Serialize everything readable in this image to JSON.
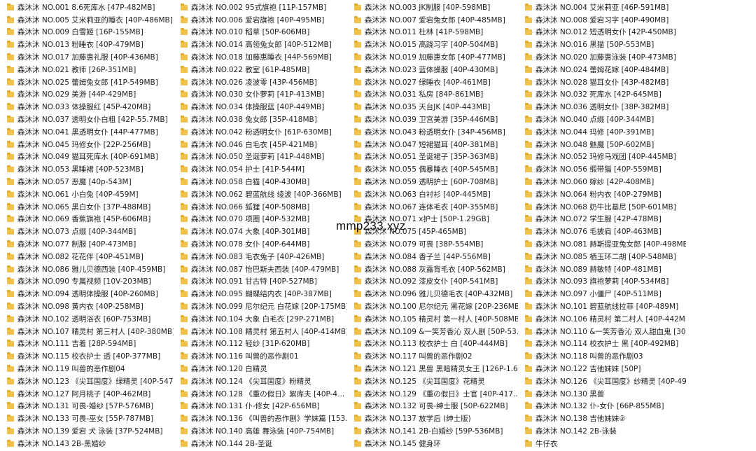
{
  "watermark": "mmp233.xyz",
  "columns": [
    [
      "森沐沐 NO.001 8.6死库水 [47P-482MB]",
      "森沐沐 NO.005 艾米莉亚的睡衣 [40P-486MB]",
      "森沐沐 NO.009 白雪姬 [16P-155MB]",
      "森沐沐 NO.013 粉睡衣 [40P-479MB]",
      "森沐沐 NO.017 加藤惠礼服 [40P-436MB]",
      "森沐沐 NO.021 教师 [26P-351MB]",
      "森沐沐 NO.025 蕾姆兔女郎 [41P-549MB]",
      "森沐沐 NO.029 美游 [44P-429MB]",
      "森沐沐 NO.033 体操服红 [45P-420MB]",
      "森沐沐 NO.037 透明女仆白粗 [42P-55.7MB]",
      "森沐沐 NO.041 黑透明女仆 [44P-477MB]",
      "森沐沐 NO.045 玛修女仆 [22P-256MB]",
      "森沐沐 NO.049 猫耳死库水 [40P-691MB]",
      "森沐沐 NO.053 黑睡裙 [40P-523MB]",
      "森沐沐 NO.057 恶魔 [40p-543M]",
      "森沐沐 NO.061 小白兔 [40P-459M]",
      "森沐沐 NO.065 黑白女仆 [37P-488MB]",
      "森沐沐 NO.069 香蕉旗袍 [45P-606MB]",
      "森沐沐 NO.073 点缀 [40P-344MB]",
      "森沐沐 NO.077 制服 [40P-473MB]",
      "森沐沐 NO.082 花花伴 [40P-451MB]",
      "森沐沐 NO.086 雅儿贝德西装 [40P-459MB]",
      "森沐沐 NO.090 专属视频 [10V-203MB]",
      "森沐沐 NO.094 透明体操服 [40P-260MB]",
      "森沐沐 NO.098 黄内衣 [40P-258MB]",
      "森沐沐 NO.102 透明浴衣 [60P-753MB]",
      "森沐沐 NO.107 精灵村 第三村人 [40P-380MB]",
      "森沐沐 NO.111 吉着 [28P-594MB]",
      "森沐沐 NO.115 校衣护士 透 [40P-377MB]",
      "森沐沐 NO.119 叫兽的恶作剧04",
      "森沐沐 NO.123 《尖耳国度》绿精灵 [40P-547...",
      "森沐沐 NO.127 阿月桃子 [40P-462MB]",
      "森沐沐 NO.131 可畏-婚纱 [57P-576MB]",
      "森沐沐 NO.133 可畏-巫女 [55P-787MB]",
      "森沐沐 NO.139 爱宕 犬 泳装 [37P-524MB]",
      "森沐沐 NO.143 2B-黑婚纱"
    ],
    [
      "森沐沐 NO.002 95式旗袍 [11P-157MB]",
      "森沐沐 NO.006 爱宕旗袍 [40P-495MB]",
      "森沐沐 NO.010 稻草 [50P-606MB]",
      "森沐沐 NO.014 高领兔女郎 [40P-512MB]",
      "森沐沐 NO.018 加藤惠睡衣 [44P-569MB]",
      "森沐沐 NO.022 教室 [61P-485MB]",
      "森沐沐 NO.026 凌波零 [43P-456MB]",
      "森沐沐 NO.030 女仆萝莉 [41P-413MB]",
      "森沐沐 NO.034 体操服蓝 [40P-449MB]",
      "森沐沐 NO.038 兔女郎 [35P-418MB]",
      "森沐沐 NO.042 粉透明女仆 [61P-630MB]",
      "森沐沐 NO.046 白毛衣 [45P-421MB]",
      "森沐沐 NO.050 圣诞萝莉 [41P-448MB]",
      "森沐沐 NO.054 护士 [41P-544M]",
      "森沐沐 NO.058 白猫 [40P-430MB]",
      "森沐沐 NO.062 碧蓝航线 绫波 [40P-366MB]",
      "森沐沐 NO.066 狐狸 [40P-508MB]",
      "森沐沐 NO.070 项圈 [40P-532MB]",
      "森沐沐 NO.074 大象 [40P-301MB]",
      "森沐沐 NO.078 女仆 [40P-644MB]",
      "森沐沐 NO.083 毛衣兔子 [40P-426MB]",
      "森沐沐 NO.087 怡巴斯夫西装 [40P-479MB]",
      "森沐沐 NO.091 甘古特 [40P-527MB]",
      "森沐沐 NO.095 蝴蝶结内衣 [40P-387MB]",
      "森沐沐 NO.099 尼尔纪元 白花嫁 [20P-175MB]",
      "森沐沐 NO.104 大象 白毛衣 [29P-271MB]",
      "森沐沐 NO.108 精灵村 第五村人 [40P-414MB]",
      "森沐沐 NO.112 轻纱 [31P-620MB]",
      "森沐沐 NO.116 叫兽的恶作剧01",
      "森沐沐 NO.120 白精灵",
      "森沐沐 NO.124 《尖耳国度》粉精灵",
      "森沐沐 NO.128 《重の假日》絮库夫 [40P-4...",
      "森沐沐 NO.131 仆-修女 [42P-656MB]",
      "森沐沐 NO.136 《叫兽的恶作剧》学妹篇 [153...",
      "森沐沐 NO.140 高雄 舞泳装 [40P-754MB]",
      "森沐沐 NO.144 2B-圣诞"
    ],
    [
      "森沐沐 NO.003 JK制服 [40P-598MB]",
      "森沐沐 NO.007 爱宕兔女郎 [40P-485MB]",
      "森沐沐 NO.011 杜林 [41P-598MB]",
      "森沐沐 NO.015 高跷习字 [40P-504MB]",
      "森沐沐 NO.019 加藤惠女郎 [40P-477MB]",
      "森沐沐 NO.023 蓝体操服 [40P-430MB]",
      "森沐沐 NO.027 绿睡衣 [40P-461MB]",
      "森沐沐 NO.031 私房 [84P-861MB]",
      "森沐沐 NO.035 天台JK [40P-443MB]",
      "森沐沐 NO.039 卫宫美游 [35P-446MB]",
      "森沐沐 NO.043 粉透明女仆 [34P-456MB]",
      "森沐沐 NO.047 短裙猫耳 [40P-381MB]",
      "森沐沐 NO.051 圣诞裙子 [35P-363MB]",
      "森沐沐 NO.055 偶暴睡衣 [40P-545MB]",
      "森沐沐 NO.059 透明护士 [60P-708MB]",
      "森沐沐 NO.063 白衬衫 [40P-445MB]",
      "森沐沐 NO.067 连体毛衣 [40P-355MB]",
      "森沐沐 NO.071 x护士 [50P-1.29GB]",
      "森沐沐 NO.075 [45P-465MB]",
      "森沐沐 NO.079 可畏 [38P-554MB]",
      "森沐沐 NO.084 香子兰 [44P-556MB]",
      "森沐沐 NO.088 灰露背毛衣 [40P-562MB]",
      "森沐沐 NO.092 漆皮女仆 [40P-541MB]",
      "森沐沐 NO.096 雅儿贝德毛衣 [40P-432MB]",
      "森沐沐 NO.100 尼尔纪元 黑花嫁 [20P-236MB]",
      "森沐沐 NO.105 精灵村 第一村人 [40P-508MB]",
      "森沐沐 NO.109 &一笑芳香沁 双人剧 [50P-53...",
      "森沐沐 NO.113 校衣护士 白 [40P-444MB]",
      "森沐沐 NO.117 叫兽的恶作剧02",
      "森沐沐 NO.121 黑兽 黑暗精灵女王 [126P-1.6...",
      "森沐沐 NO.125 《尖耳国度》花精灵",
      "森沐沐 NO.129 《重の假日》士官 [40P-417...",
      "森沐沐 NO.132 可畏-绅士服 [50P-622MB]",
      "森沐沐 NO.137 放学后 (绅士版)",
      "森沐沐 NO.141 2B-白婚纱 [59P-536MB]",
      "森沐沐 NO.145 健身环"
    ],
    [
      "森沐沐 NO.004 艾米莉亚 [46P-591MB]",
      "森沐沐 NO.008 爱宕习字 [40P-490MB]",
      "森沐沐 NO.012 短透明女仆 [42P-450MB]",
      "森沐沐 NO.016 黑猫 [50P-553MB]",
      "森沐沐 NO.020 加藤惠泳装 [40P-473MB]",
      "森沐沐 NO.024 蕾姆花嫁 [40P-484MB]",
      "森沐沐 NO.028 猫耳女仆 [43P-482MB]",
      "森沐沐 NO.032 死库水 [42P-645MB]",
      "森沐沐 NO.036 透明女仆 [38P-382MB]",
      "森沐沐 NO.040 点缀 [40P-344MB]",
      "森沐沐 NO.044 玛修 [40P-391MB]",
      "森沐沐 NO.048 魅魔 [50P-602MB]",
      "森沐沐 NO.052 玛修马戏团 [40P-445MB]",
      "森沐沐 NO.056 缎带猫 [40P-559MB]",
      "森沐沐 NO.060 嫁纱 [42P-408MB]",
      "森沐沐 NO.064 粉内衣 [40P-279MB]",
      "森沐沐 NO.068 奶牛比基尼 [50P-601MB]",
      "森沐沐 NO.072 学生服 [42P-478MB]",
      "森沐沐 NO.076 毛披肩 [40P-463MB]",
      "森沐沐 NO.081 赫斯提亚兔女郎 [40P-498MB]",
      "森沐沐 NO.085 栖玉环二胡 [40P-548MB]",
      "森沐沐 NO.089 赫敏特 [40P-481MB]",
      "森沐沐 NO.093 旗袍萝莉 [40P-534MB]",
      "森沐沐 NO.097 小僵尸 [40P-511MB]",
      "森沐沐 NO.101 碧蓝航线拉菲 [40P-489M]",
      "森沐沐 NO.106 精灵村 第二村人 [40P-442MB]",
      "森沐沐 NO.110 &一笑芳香沁 双人甜血鬼 [30...",
      "森沐沐 NO.114 校衣护士 黑 [40P-492MB]",
      "森沐沐 NO.118 叫兽的恶作剧03",
      "森沐沐 NO.122 吉他妹妹 [50P]",
      "森沐沐 NO.126 《尖耳国度》纱精灵 [40P-49...",
      "森沐沐 NO.130 黑兽",
      "森沐沐 NO.132 仆-女仆 [66P-855MB]",
      "森沐沐 NO.138 吉他妹妹②",
      "森沐沐 NO.142 2B-泳装",
      "牛仔衣"
    ]
  ]
}
